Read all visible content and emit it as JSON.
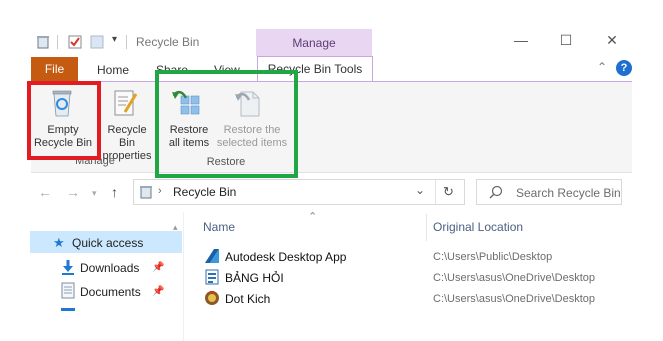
{
  "window": {
    "title": "Recycle Bin",
    "context_tab_group": "Manage",
    "controls": {
      "minimize": "—",
      "maximize": "☐",
      "close": "✕"
    }
  },
  "tabs": [
    {
      "label": "File"
    },
    {
      "label": "Home"
    },
    {
      "label": "Share"
    },
    {
      "label": "View"
    },
    {
      "label": "Recycle Bin Tools"
    }
  ],
  "ribbon": {
    "groups": [
      {
        "label": "Manage",
        "buttons": [
          {
            "label_line1": "Empty",
            "label_line2": "Recycle Bin",
            "icon": "recycle-bin-icon"
          },
          {
            "label_line1": "Recycle Bin",
            "label_line2": "properties",
            "icon": "properties-icon"
          }
        ]
      },
      {
        "label": "Restore",
        "buttons": [
          {
            "label_line1": "Restore",
            "label_line2": "all items",
            "icon": "restore-all-icon"
          },
          {
            "label_line1": "Restore the",
            "label_line2": "selected items",
            "icon": "restore-selected-icon",
            "disabled": true
          }
        ]
      }
    ],
    "highlight_colors": {
      "red": "#e31b23",
      "green": "#21a645"
    }
  },
  "address": {
    "path": "Recycle Bin",
    "search_placeholder": "Search Recycle Bin"
  },
  "sidebar": {
    "items": [
      {
        "label": "Quick access",
        "icon": "star-icon",
        "selected": true
      },
      {
        "label": "Downloads",
        "icon": "download-icon",
        "pinned": true
      },
      {
        "label": "Documents",
        "icon": "document-icon",
        "pinned": true
      }
    ]
  },
  "columns": {
    "name": "Name",
    "location": "Original Location"
  },
  "files": [
    {
      "name": "Autodesk Desktop App",
      "location": "C:\\Users\\Public\\Desktop",
      "icon": "autodesk-icon"
    },
    {
      "name": "BẢNG HỎI",
      "location": "C:\\Users\\asus\\OneDrive\\Desktop",
      "icon": "spreadsheet-icon"
    },
    {
      "name": "Dot Kich",
      "location": "C:\\Users\\asus\\OneDrive\\Desktop",
      "icon": "game-icon"
    }
  ]
}
